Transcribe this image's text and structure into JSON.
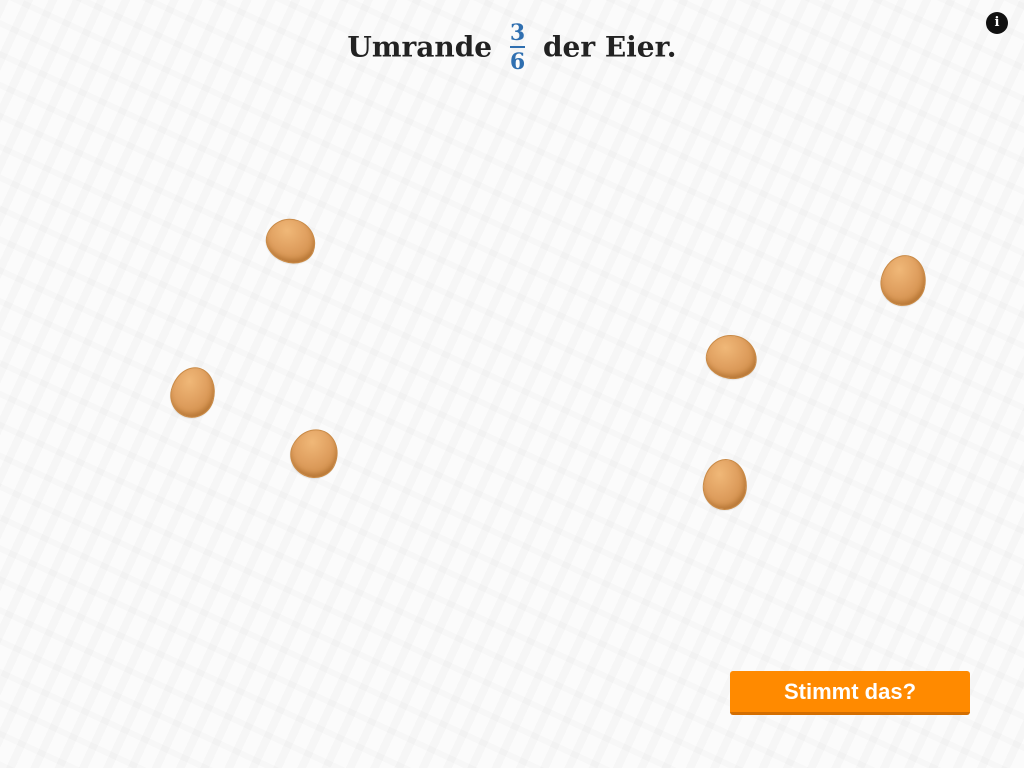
{
  "prompt": {
    "before": "Umrande",
    "fraction": {
      "numerator": "3",
      "denominator": "6"
    },
    "after": "der Eier."
  },
  "info_button": {
    "label": "i",
    "icon": "info-icon"
  },
  "eggs": {
    "count": 6,
    "selected": 0
  },
  "check_button": {
    "label": "Stimmt das?"
  },
  "colors": {
    "accent": "#ff8a00",
    "fraction": "#2f6fb0",
    "egg": "#e0a060"
  }
}
